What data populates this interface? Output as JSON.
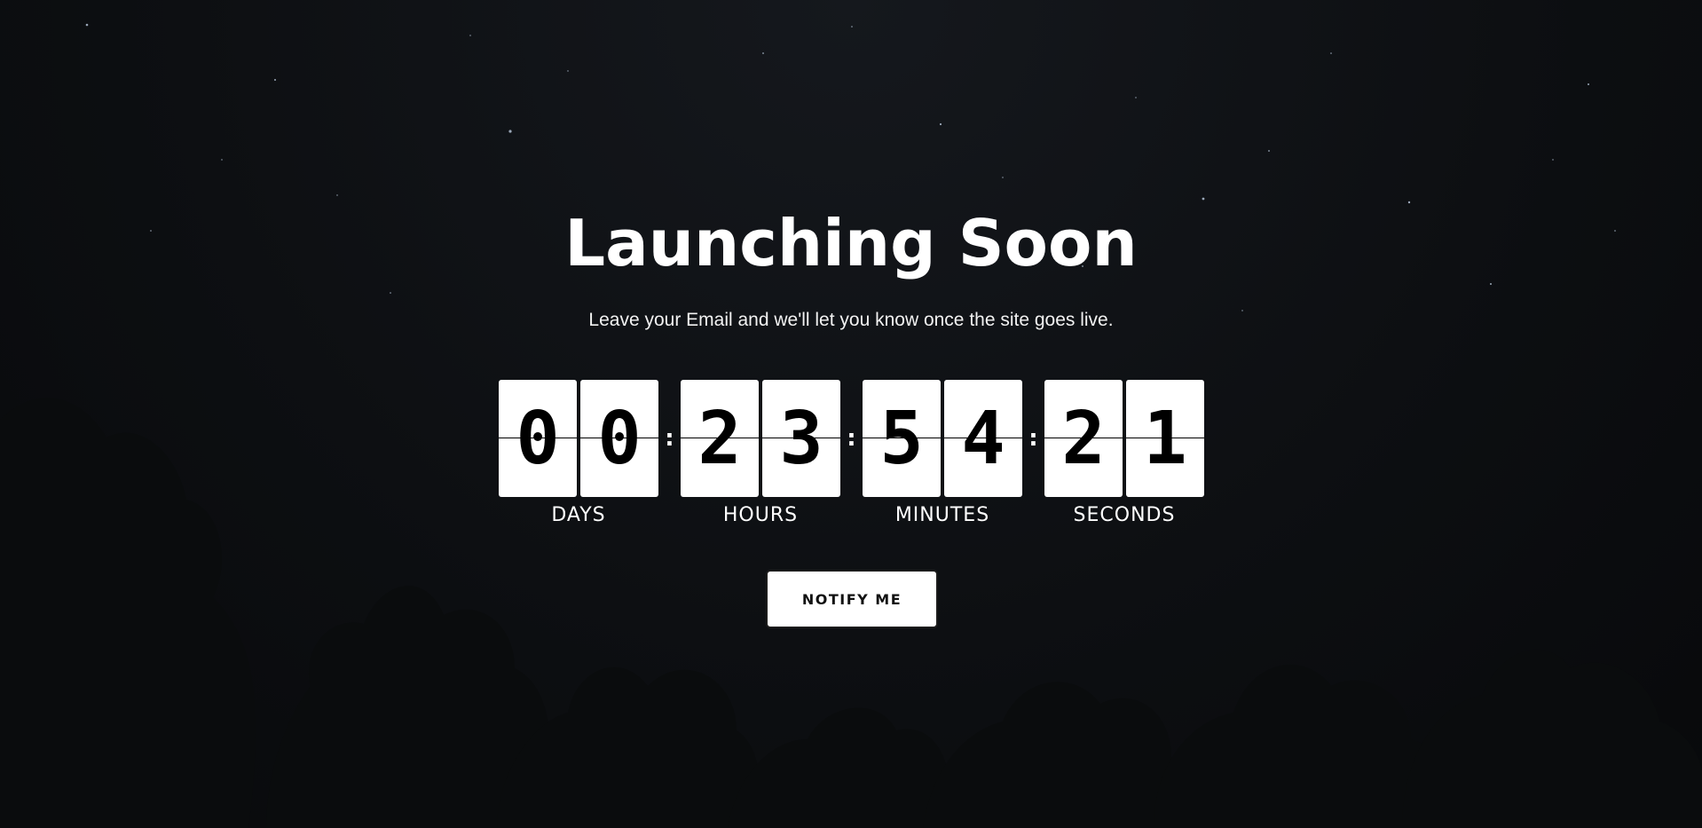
{
  "hero": {
    "title": "Launching Soon",
    "subtitle": "Leave your Email and we'll let you know once the site goes live."
  },
  "countdown": {
    "days": {
      "digits": [
        "0",
        "0"
      ],
      "label": "DAYS"
    },
    "hours": {
      "digits": [
        "2",
        "3"
      ],
      "label": "HOURS"
    },
    "minutes": {
      "digits": [
        "5",
        "4"
      ],
      "label": "MINUTES"
    },
    "seconds": {
      "digits": [
        "2",
        "1"
      ],
      "label": "SECONDS"
    },
    "separator": ":"
  },
  "cta": {
    "label": "NOTIFY ME"
  },
  "theme": {
    "background": "#0b0d10",
    "text": "#ffffff",
    "card": "#ffffff",
    "card_text": "#000000"
  }
}
